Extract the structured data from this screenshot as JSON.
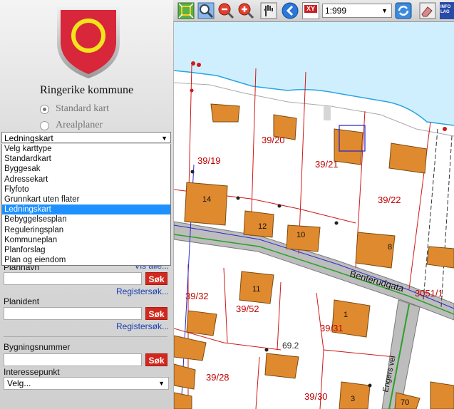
{
  "municipality": {
    "name": "Ringerike kommune"
  },
  "map_type": {
    "options": [
      "Standard kart",
      "Arealplaner"
    ],
    "selected": "Standard kart"
  },
  "layer_select": {
    "value": "Ledningskart",
    "options": [
      "Velg karttype",
      "Standardkart",
      "Byggesak",
      "Adressekart",
      "Flyfoto",
      "Grunnkart uten flater",
      "Ledningskart",
      "Bebyggelsesplan",
      "Reguleringsplan",
      "Kommuneplan",
      "Planforslag",
      "Plan og eiendom"
    ],
    "selected_index": 6
  },
  "search": {
    "partial_link": "Vis alle...",
    "partial_label": "Plannavn",
    "search_label": "Søk",
    "register_link": "Registersøk...",
    "planident_label": "Planident",
    "building_label": "Bygningsnummer",
    "interest_label": "Interessepunkt",
    "interest_value": "Velg..."
  },
  "toolbar": {
    "scale": "1:999",
    "xy_label": "XY",
    "info_label": "INFO LAG",
    "icons": [
      "zoom-extent-icon",
      "zoom-window-icon",
      "zoom-out-icon",
      "zoom-in-icon",
      "pan-hand-icon",
      "back-arrow-icon",
      "xy-coordinate-icon",
      "refresh-icon",
      "eraser-icon",
      "info-layer-icon"
    ]
  },
  "map": {
    "plot_labels": [
      "39/20",
      "39/19",
      "39/21",
      "39/22",
      "39/32",
      "39/52",
      "3051/1",
      "39/31",
      "39/28",
      "39/30"
    ],
    "building_numbers": [
      "14",
      "12",
      "10",
      "8",
      "11",
      "1",
      "3",
      "70"
    ],
    "street_names": [
      "Benterudgata",
      "Engers vei"
    ],
    "elevation": "69.2"
  },
  "colors": {
    "search_button": "#d2281e",
    "selected_option": "#1e90ff",
    "crest_red": "#d8263a",
    "crest_yellow": "#f2e41c",
    "water": "#cfefff",
    "building": "#e08a30",
    "plot_label": "#c00000"
  }
}
